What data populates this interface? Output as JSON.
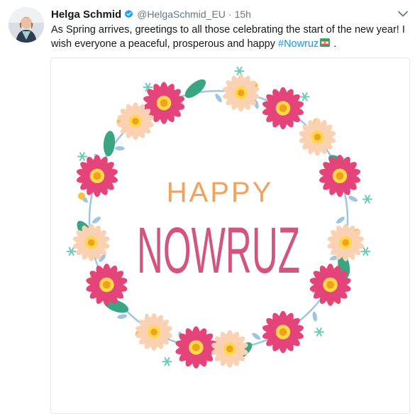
{
  "author": {
    "name": "Helga Schmid",
    "handle": "@HelgaSchmid_EU",
    "separator": "·",
    "time": "15h",
    "verified": true
  },
  "tweet": {
    "text_before": "As Spring arrives, greetings to all those celebrating the start of the new year! I wish everyone a peaceful, prosperous and happy ",
    "hashtag": "#Nowruz",
    "text_after": " ."
  },
  "media": {
    "line1": "HAPPY",
    "line2": "NOWRUZ"
  },
  "icons": {
    "verified": "verified-badge-icon",
    "caret": "chevron-down-icon",
    "emoji": "flag-emoji-icon"
  },
  "colors": {
    "hashtag": "#1b95e0",
    "happy": "#f4a259",
    "nowruz": "#d3557f",
    "pink_flower": "#e5447a",
    "peach_flower": "#fad2b3",
    "leaf_green": "#3aa582",
    "berry_yellow": "#f5c242",
    "twig_blue": "#9ec5e6"
  }
}
